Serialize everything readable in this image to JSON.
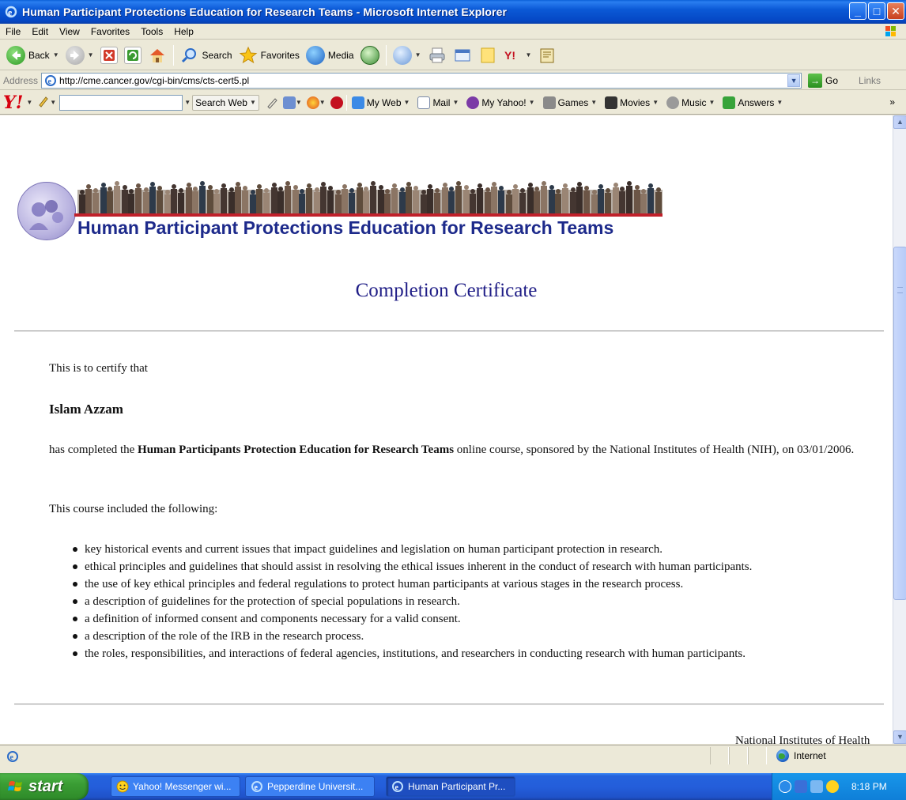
{
  "window": {
    "title": "Human Participant Protections Education for Research Teams - Microsoft Internet Explorer"
  },
  "menu": [
    "File",
    "Edit",
    "View",
    "Favorites",
    "Tools",
    "Help"
  ],
  "toolbar": {
    "back_label": "Back",
    "search_label": "Search",
    "favorites_label": "Favorites",
    "media_label": "Media"
  },
  "address": {
    "label": "Address",
    "url": "http://cme.cancer.gov/cgi-bin/cms/cts-cert5.pl",
    "go_label": "Go",
    "links_label": "Links"
  },
  "yahoo_toolbar": {
    "logo": "Y!",
    "search_placeholder": "",
    "search_button_label": "Search Web",
    "items": [
      "My Web",
      "Mail",
      "My Yahoo!",
      "Games",
      "Movies",
      "Music",
      "Answers"
    ],
    "more": "»"
  },
  "page": {
    "banner_title": "Human Participant Protections Education for Research Teams",
    "certificate_title": "Completion Certificate",
    "certify_intro": "This is to certify that",
    "recipient_name": "Islam Azzam",
    "completion_prefix": "has completed the ",
    "course_name": "Human Participants Protection Education for Research Teams",
    "completion_suffix": " online course, sponsored by the National Institutes of Health (NIH), on 03/01/2006.",
    "included_intro": "This course included the following:",
    "topics": [
      "key historical events and current issues that impact guidelines and legislation on human participant protection in research.",
      "ethical principles and guidelines that should assist in resolving the ethical issues inherent in the conduct of research with human participants.",
      "the use of key ethical principles and federal regulations to protect human participants at various stages in the research process.",
      "a description of guidelines for the protection of special populations in research.",
      "a definition of informed consent and components necessary for a valid consent.",
      "a description of the role of the IRB in the research process.",
      "the roles, responsibilities, and interactions of federal agencies, institutions, and researchers in conducting research with human participants."
    ],
    "footer_org": "National Institutes of Health"
  },
  "status": {
    "zone": "Internet"
  },
  "taskbar": {
    "start_label": "start",
    "tasks": [
      {
        "label": "Yahoo! Messenger wi..."
      },
      {
        "label": "Pepperdine Universit..."
      },
      {
        "label": "Human Participant Pr..."
      }
    ],
    "clock": "8:18 PM"
  },
  "colors": {
    "xp_blue": "#0a5fd8",
    "banner_title": "#1d2a8b",
    "cert_title": "#1f1d86",
    "banner_rule": "#c0202a"
  }
}
